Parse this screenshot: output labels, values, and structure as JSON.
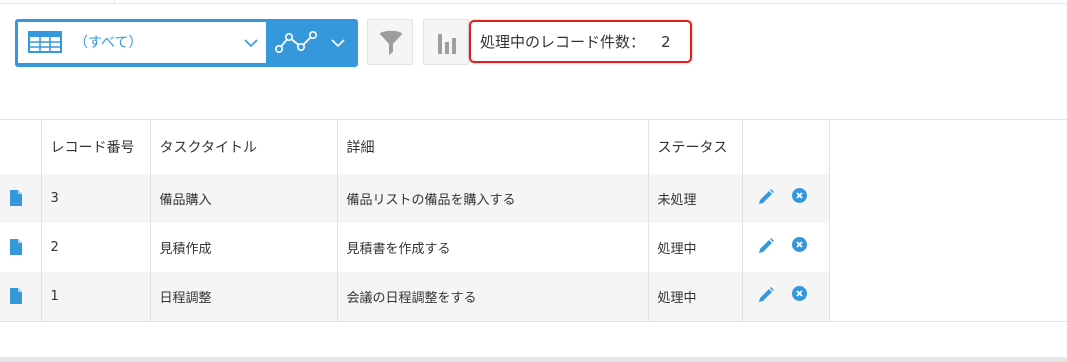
{
  "toolbar": {
    "view_select": {
      "value": "（すべて）",
      "icon": "table-icon"
    },
    "graph_menu": {
      "icon": "line-graph-icon"
    },
    "filter_button": {
      "icon": "funnel-icon"
    },
    "graph_button": {
      "icon": "bar-chart-icon"
    },
    "record_count": {
      "label": "処理中のレコード件数：",
      "value": "2"
    }
  },
  "table": {
    "headers": [
      "レコード番号",
      "タスクタイトル",
      "詳細",
      "ステータス"
    ],
    "rows": [
      {
        "number": "3",
        "title": "備品購入",
        "detail": "備品リストの備品を購入する",
        "status": "未処理"
      },
      {
        "number": "2",
        "title": "見積作成",
        "detail": "見積書を作成する",
        "status": "処理中"
      },
      {
        "number": "1",
        "title": "日程調整",
        "detail": "会議の日程調整をする",
        "status": "処理中"
      }
    ]
  },
  "colors": {
    "accent": "#3498db",
    "highlight_border": "#e02020",
    "row_stripe": "#f5f5f5",
    "icon_gray": "#9e9e9e"
  }
}
